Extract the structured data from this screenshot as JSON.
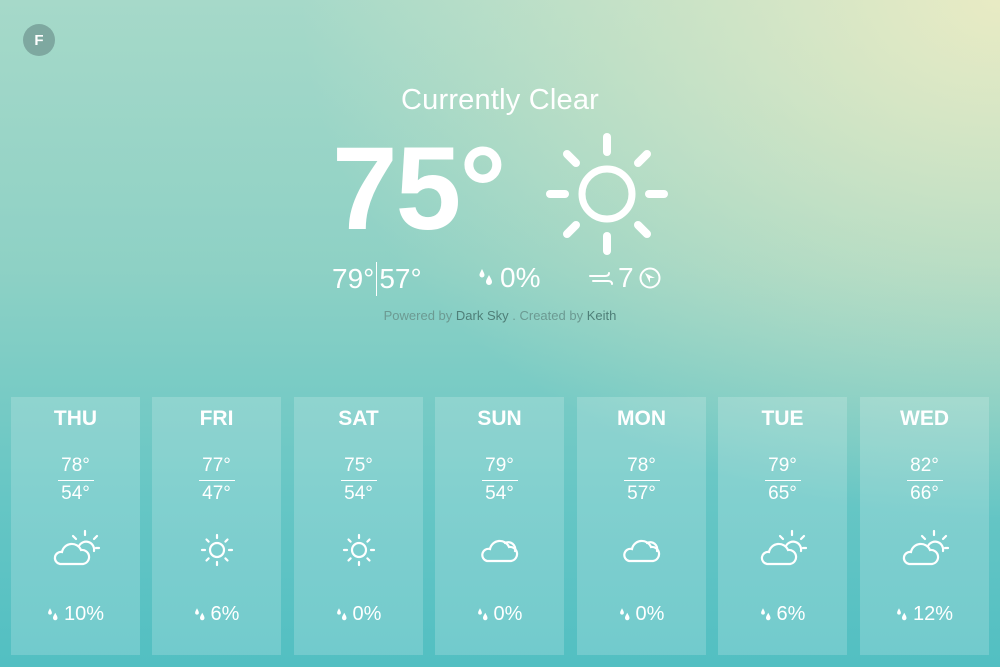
{
  "unit_toggle": {
    "label": "F"
  },
  "current": {
    "summary": "Currently Clear",
    "temperature": "75°",
    "icon": "sun-icon",
    "high": "79°",
    "low": "57°",
    "precip": "0%",
    "wind": "7"
  },
  "credits": {
    "prefix": "Powered by",
    "source_link": "Dark Sky",
    "middle": ". Created by",
    "author_link": "Keith"
  },
  "forecast": [
    {
      "day": "THU",
      "high": "78°",
      "low": "54°",
      "icon": "partly-cloudy-icon",
      "precip": "10%"
    },
    {
      "day": "FRI",
      "high": "77°",
      "low": "47°",
      "icon": "sun-icon",
      "precip": "6%"
    },
    {
      "day": "SAT",
      "high": "75°",
      "low": "54°",
      "icon": "sun-icon",
      "precip": "0%"
    },
    {
      "day": "SUN",
      "high": "79°",
      "low": "54°",
      "icon": "cloud-icon",
      "precip": "0%"
    },
    {
      "day": "MON",
      "high": "78°",
      "low": "57°",
      "icon": "cloud-icon",
      "precip": "0%"
    },
    {
      "day": "TUE",
      "high": "79°",
      "low": "65°",
      "icon": "partly-cloudy-icon",
      "precip": "6%"
    },
    {
      "day": "WED",
      "high": "82°",
      "low": "66°",
      "icon": "partly-cloudy-icon",
      "precip": "12%"
    }
  ],
  "colors": {
    "text": "#ffffff",
    "credits_text": "#6c9a92",
    "credits_link": "#4f7f78",
    "toggle_bg": "#7ea8a0"
  }
}
